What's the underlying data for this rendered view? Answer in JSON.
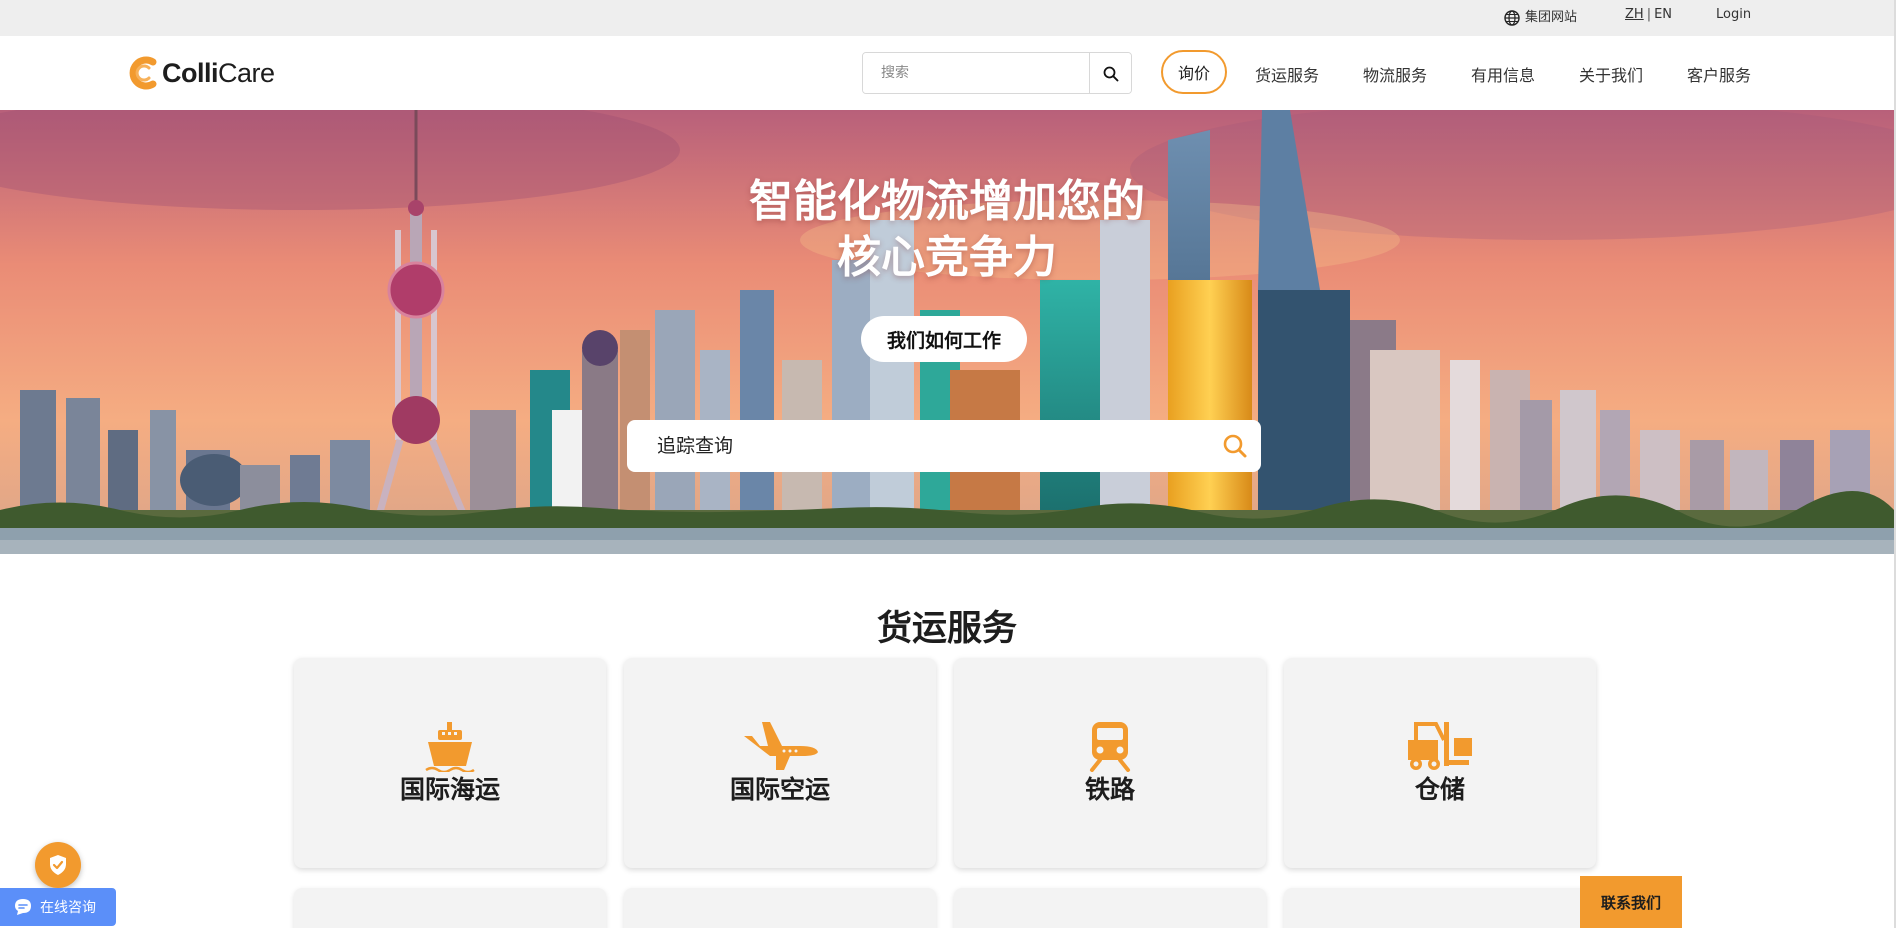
{
  "utility_bar": {
    "group_site_label": "集团网站",
    "lang_zh": "ZH",
    "lang_separator": "|",
    "lang_en": "EN",
    "login_label": "Login"
  },
  "header": {
    "logo_bold": "Colli",
    "logo_regular": "Care",
    "search_placeholder": "搜索",
    "nav": {
      "quote": "询价",
      "freight": "货运服务",
      "logistics": "物流服务",
      "info": "有用信息",
      "about": "关于我们",
      "support": "客户服务"
    }
  },
  "hero": {
    "title_line1": "智能化物流增加您的",
    "title_line2": "核心竞争力",
    "cta_label": "我们如何工作",
    "track_placeholder": "追踪查询"
  },
  "services": {
    "title": "货运服务",
    "cards": [
      {
        "label": "国际海运",
        "icon": "ship-icon"
      },
      {
        "label": "国际空运",
        "icon": "airplane-icon"
      },
      {
        "label": "铁路",
        "icon": "train-icon"
      },
      {
        "label": "仓储",
        "icon": "forklift-icon"
      }
    ]
  },
  "widgets": {
    "chat_label": "在线咨询",
    "contact_label": "联系我们"
  },
  "colors": {
    "accent": "#f29a2e",
    "chat": "#5b8ff9",
    "card_bg": "#f3f3f3",
    "util_bar": "#eeeeee"
  }
}
